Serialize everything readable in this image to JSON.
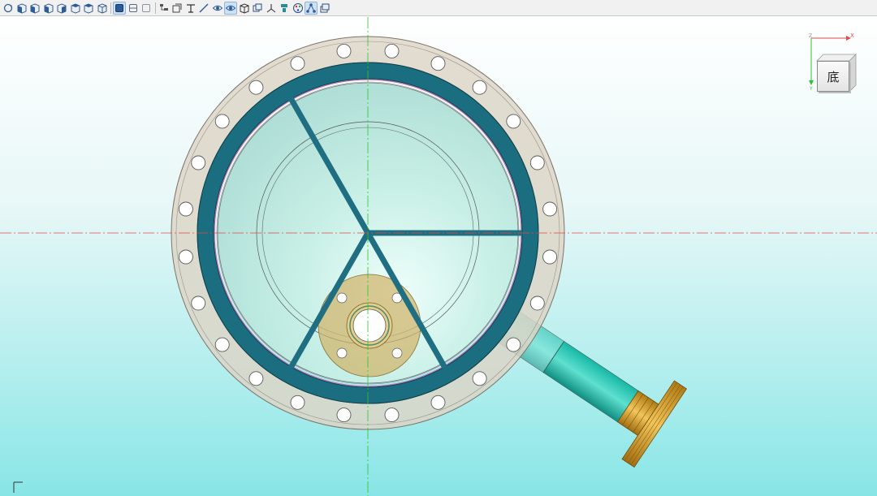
{
  "toolbar": {
    "groups": [
      [
        {
          "name": "rotate-view-icon",
          "active": false
        },
        {
          "name": "view-front-icon",
          "active": false
        },
        {
          "name": "view-back-icon",
          "active": false
        },
        {
          "name": "view-left-icon",
          "active": false
        },
        {
          "name": "view-right-icon",
          "active": false
        },
        {
          "name": "view-top-icon",
          "active": false
        },
        {
          "name": "view-bottom-icon",
          "active": false
        },
        {
          "name": "view-isometric-icon",
          "active": false
        }
      ],
      [
        {
          "name": "shaded-mode-icon",
          "active": true
        },
        {
          "name": "wireframe-mode-icon",
          "active": false
        },
        {
          "name": "hidden-line-mode-icon",
          "active": false
        }
      ],
      [
        {
          "name": "model-tree-icon",
          "active": false
        },
        {
          "name": "section-view-icon",
          "active": false
        },
        {
          "name": "dimension-icon",
          "active": false
        },
        {
          "name": "measure-icon",
          "active": false
        },
        {
          "name": "hide-icon",
          "active": false
        },
        {
          "name": "show-all-icon",
          "active": true
        },
        {
          "name": "part-icon",
          "active": false
        },
        {
          "name": "assembly-icon",
          "active": false
        },
        {
          "name": "axis-triad-icon",
          "active": false
        },
        {
          "name": "explode-icon",
          "active": false
        },
        {
          "name": "palette-icon",
          "active": false
        },
        {
          "name": "structure-icon",
          "active": true
        },
        {
          "name": "layers-icon",
          "active": false
        }
      ]
    ]
  },
  "view_cube": {
    "face_label": "底",
    "axis_x": "X",
    "axis_y": "Y",
    "axis_z": "Z"
  },
  "colors": {
    "toolbar_bg": "#f1f1f1",
    "viewport_top": "#ffffff",
    "viewport_bottom": "#88e5e6",
    "flange_face": "#d8d2c8",
    "gasket_ring": "#1a6e80",
    "vessel_glass": "#bde9df",
    "rib": "#1f6e82",
    "nozzle_pipe": "#1fb0a0",
    "nozzle_flange": "#c58f1e",
    "crosshair_h": "#e04a4a",
    "crosshair_v": "#2ec22e"
  }
}
